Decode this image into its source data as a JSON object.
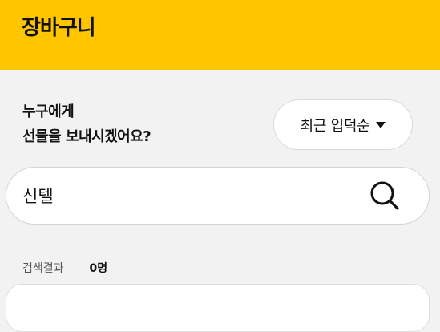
{
  "header": {
    "title": "장바구니"
  },
  "prompt": {
    "line1": "누구에게",
    "line2": "선물을 보내시겠어요?"
  },
  "sort": {
    "label": "최근 입덕순",
    "icon": "caret-down-icon"
  },
  "search": {
    "value": "신텔",
    "icon": "search-icon"
  },
  "results": {
    "label": "검색결과",
    "count": "0명"
  },
  "colors": {
    "brand": "#ffc600",
    "background": "#f2f2f2"
  }
}
